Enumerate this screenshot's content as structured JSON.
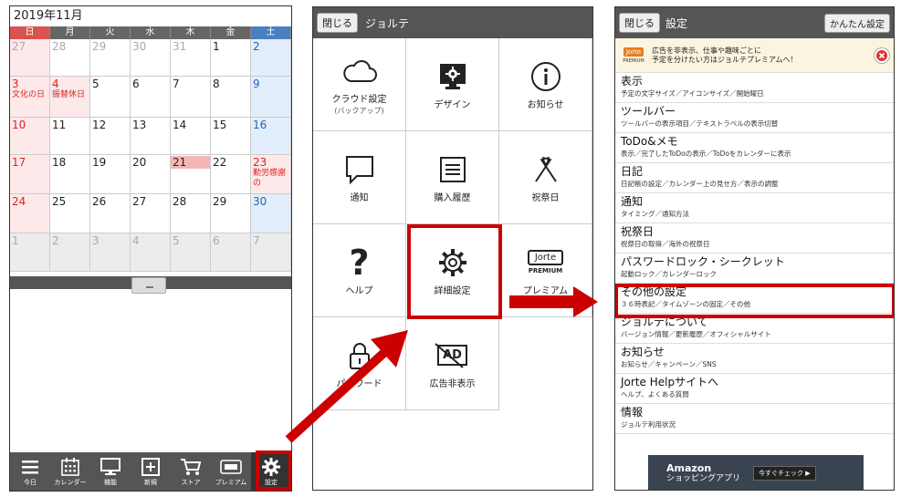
{
  "colors": {
    "accent_red": "#cc0000",
    "header_gray": "#555555",
    "sunday": "#dd2222",
    "saturday": "#2a63b5"
  },
  "calendar": {
    "title": "2019年11月",
    "weekdays": [
      "日",
      "月",
      "火",
      "水",
      "木",
      "金",
      "土"
    ],
    "weeks": [
      [
        {
          "d": "27",
          "dim": true
        },
        {
          "d": "28",
          "dim": true
        },
        {
          "d": "29",
          "dim": true
        },
        {
          "d": "30",
          "dim": true
        },
        {
          "d": "31",
          "dim": true
        },
        {
          "d": "1"
        },
        {
          "d": "2"
        }
      ],
      [
        {
          "d": "3",
          "hol": "文化の日"
        },
        {
          "d": "4",
          "hol": "振替休日"
        },
        {
          "d": "5"
        },
        {
          "d": "6"
        },
        {
          "d": "7"
        },
        {
          "d": "8"
        },
        {
          "d": "9"
        }
      ],
      [
        {
          "d": "10"
        },
        {
          "d": "11"
        },
        {
          "d": "12"
        },
        {
          "d": "13"
        },
        {
          "d": "14"
        },
        {
          "d": "15"
        },
        {
          "d": "16"
        }
      ],
      [
        {
          "d": "17"
        },
        {
          "d": "18"
        },
        {
          "d": "19"
        },
        {
          "d": "20"
        },
        {
          "d": "21",
          "today": true
        },
        {
          "d": "22"
        },
        {
          "d": "23",
          "hol": "勤労感謝の"
        }
      ],
      [
        {
          "d": "24"
        },
        {
          "d": "25"
        },
        {
          "d": "26"
        },
        {
          "d": "27"
        },
        {
          "d": "28"
        },
        {
          "d": "29"
        },
        {
          "d": "30"
        }
      ],
      [
        {
          "d": "1",
          "dim": true
        },
        {
          "d": "2",
          "dim": true
        },
        {
          "d": "3",
          "dim": true
        },
        {
          "d": "4",
          "dim": true
        },
        {
          "d": "5",
          "dim": true
        },
        {
          "d": "6",
          "dim": true
        },
        {
          "d": "7",
          "dim": true
        }
      ]
    ],
    "toolbar": [
      {
        "label": "今日",
        "icon": "menu-icon"
      },
      {
        "label": "カレンダー",
        "icon": "calendar-icon"
      },
      {
        "label": "機能",
        "icon": "monitor-icon"
      },
      {
        "label": "新規",
        "icon": "plus-icon"
      },
      {
        "label": "ストア",
        "icon": "cart-icon"
      },
      {
        "label": "プレミアム",
        "icon": "jorte-premium-icon"
      },
      {
        "label": "設定",
        "icon": "gear-icon"
      }
    ]
  },
  "menu": {
    "close_label": "閉じる",
    "title": "ジョルテ",
    "items": [
      {
        "label": "クラウド設定",
        "sub": "(バックアップ)",
        "icon": "cloud-icon"
      },
      {
        "label": "デザイン",
        "icon": "design-icon"
      },
      {
        "label": "お知らせ",
        "icon": "info-icon"
      },
      {
        "label": "通知",
        "icon": "speech-bubble-icon"
      },
      {
        "label": "購入履歴",
        "icon": "receipt-icon"
      },
      {
        "label": "祝祭日",
        "icon": "flags-icon"
      },
      {
        "label": "ヘルプ",
        "icon": "question-icon"
      },
      {
        "label": "詳細設定",
        "icon": "gear-icon"
      },
      {
        "label": "プレミアム",
        "icon": "jorte-premium-icon"
      },
      {
        "label": "パスワード",
        "icon": "lock-icon"
      },
      {
        "label": "広告非表示",
        "icon": "ad-off-icon"
      }
    ],
    "premium_logo": "Jorte",
    "premium_logo_sub": "PREMIUM",
    "ad_icon_text": "AD"
  },
  "settings": {
    "close_label": "閉じる",
    "title": "設定",
    "easy_label": "かんたん設定",
    "promo": {
      "logo": "Jorte",
      "logo_sub": "PREMIUM",
      "line1": "広告を非表示、仕事や趣味ごとに",
      "line2": "予定を分けたい方はジョルテプレミアムへ！"
    },
    "rows": [
      {
        "title": "表示",
        "sub": "予定の文字サイズ／アイコンサイズ／開始曜日"
      },
      {
        "title": "ツールバー",
        "sub": "ツールバーの表示項目／テキストラベルの表示切替"
      },
      {
        "title": "ToDo&メモ",
        "sub": "表示／完了したToDoの表示／ToDoをカレンダーに表示"
      },
      {
        "title": "日記",
        "sub": "日記帳の設定／カレンダー上の見せ方／表示の調整"
      },
      {
        "title": "通知",
        "sub": "タイミング／通知方法"
      },
      {
        "title": "祝祭日",
        "sub": "祝祭日の取得／海外の祝祭日"
      },
      {
        "title": "パスワードロック・シークレット",
        "sub": "起動ロック／カレンダーロック"
      },
      {
        "title": "その他の設定",
        "sub": "３６時表記／タイムゾーンの固定／その他"
      },
      {
        "title": "ジョルテについて",
        "sub": "バージョン情報／更新履歴／オフィシャルサイト"
      },
      {
        "title": "お知らせ",
        "sub": "お知らせ／キャンペーン／SNS"
      },
      {
        "title": "Jorte Helpサイトへ",
        "sub": "ヘルプ、よくある質問"
      },
      {
        "title": "情報",
        "sub": "ジョルテ利用状況"
      }
    ],
    "ad": {
      "title": "Amazon",
      "subtitle": "ショッピングアプリ",
      "button": "今すぐチェック ▶"
    }
  }
}
